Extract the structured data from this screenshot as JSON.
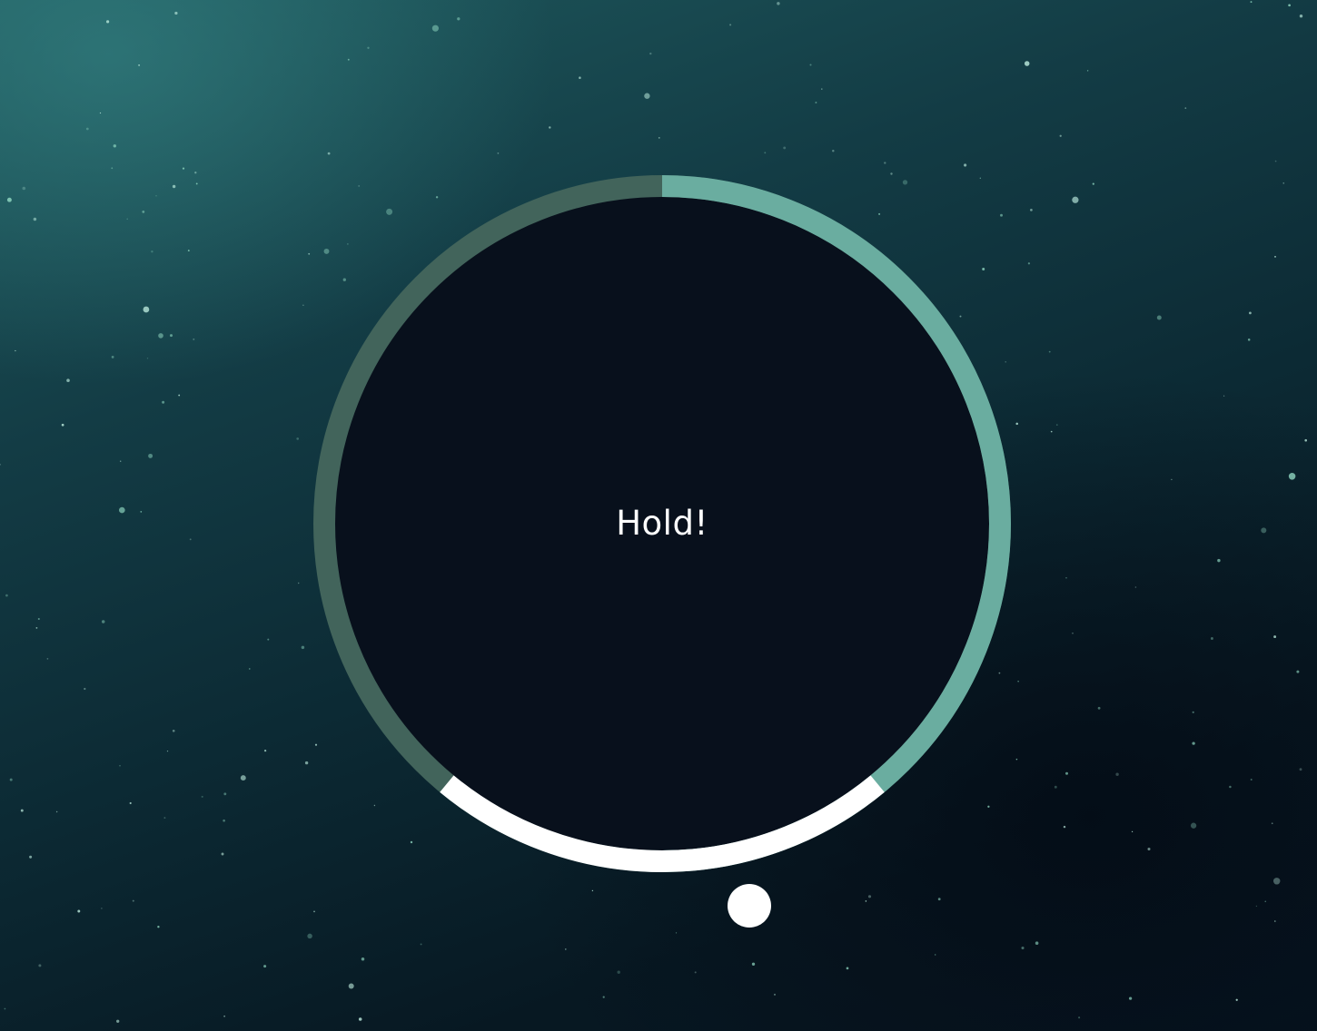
{
  "game": {
    "hold_text": "Hold!"
  },
  "timer": {
    "elapsed_fraction": 0.5,
    "target_zone_fraction": 0.22
  },
  "colors": {
    "background_dark": "#061420",
    "background_teal": "#1f5a5e",
    "dial_face": "#08101c",
    "ring_track": "#42645b",
    "ring_progress": "#6aada0",
    "target_zone": "#ffffff",
    "dot": "#ffffff",
    "text": "#ffffff"
  },
  "icons": {
    "marker": "white-dot-icon"
  }
}
